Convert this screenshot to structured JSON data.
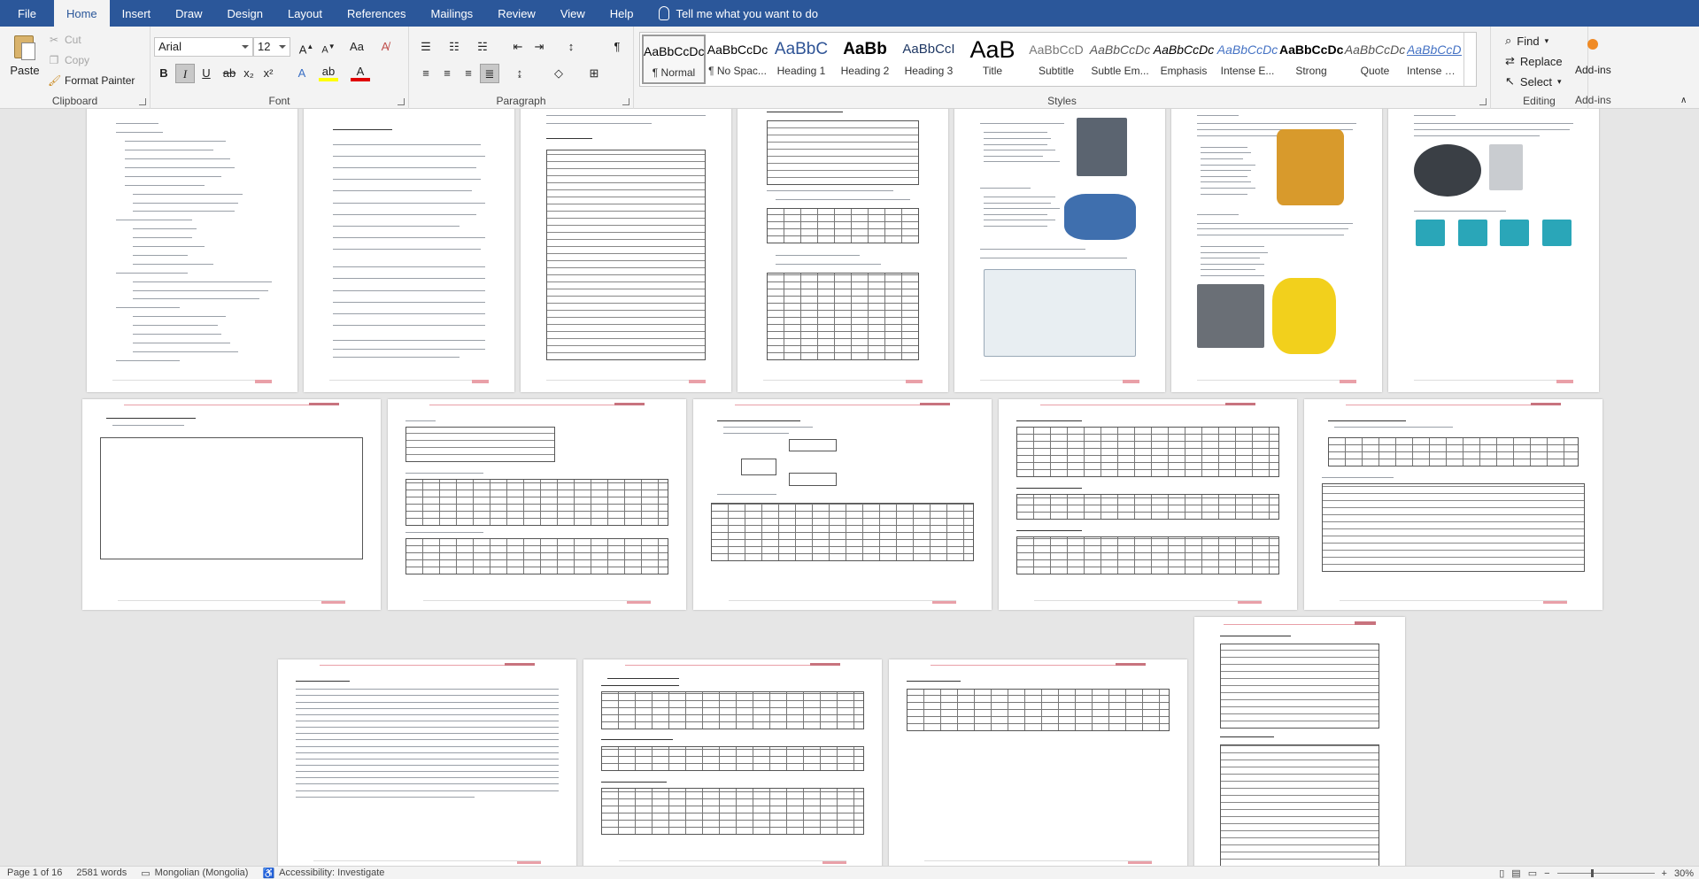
{
  "menu": {
    "tabs": [
      "File",
      "Home",
      "Insert",
      "Draw",
      "Design",
      "Layout",
      "References",
      "Mailings",
      "Review",
      "View",
      "Help"
    ],
    "active": "Home",
    "tell_me": "Tell me what you want to do"
  },
  "ribbon": {
    "clipboard": {
      "paste": "Paste",
      "cut": "Cut",
      "copy": "Copy",
      "format_painter": "Format Painter",
      "label": "Clipboard"
    },
    "font": {
      "name": "Arial",
      "size": "12",
      "label": "Font",
      "bold": "B",
      "italic": "I",
      "underline": "U",
      "strike": "ab",
      "subscript": "x₂",
      "superscript": "x²"
    },
    "paragraph": {
      "label": "Paragraph"
    },
    "styles": {
      "label": "Styles",
      "items": [
        {
          "sample": "AaBbCcDc",
          "name": "¶ Normal"
        },
        {
          "sample": "AaBbCcDc",
          "name": "¶ No Spac..."
        },
        {
          "sample": "AaBbC",
          "name": "Heading 1"
        },
        {
          "sample": "AaBb",
          "name": "Heading 2"
        },
        {
          "sample": "AaBbCcI",
          "name": "Heading 3"
        },
        {
          "sample": "AaB",
          "name": "Title"
        },
        {
          "sample": "AaBbCcD",
          "name": "Subtitle"
        },
        {
          "sample": "AaBbCcDc",
          "name": "Subtle Em..."
        },
        {
          "sample": "AaBbCcDc",
          "name": "Emphasis"
        },
        {
          "sample": "AaBbCcDc",
          "name": "Intense E..."
        },
        {
          "sample": "AaBbCcDc",
          "name": "Strong"
        },
        {
          "sample": "AaBbCcDc",
          "name": "Quote"
        },
        {
          "sample": "AaBbCcDc",
          "name": "Intense Q..."
        }
      ]
    },
    "editing": {
      "find": "Find",
      "replace": "Replace",
      "select": "Select",
      "label": "Editing"
    },
    "addins": {
      "button": "Add-ins",
      "label": "Add-ins"
    }
  },
  "status": {
    "page": "Page 1 of 16",
    "words": "2581 words",
    "language": "Mongolian (Mongolia)",
    "accessibility": "Accessibility: Investigate",
    "zoom": "30%"
  }
}
